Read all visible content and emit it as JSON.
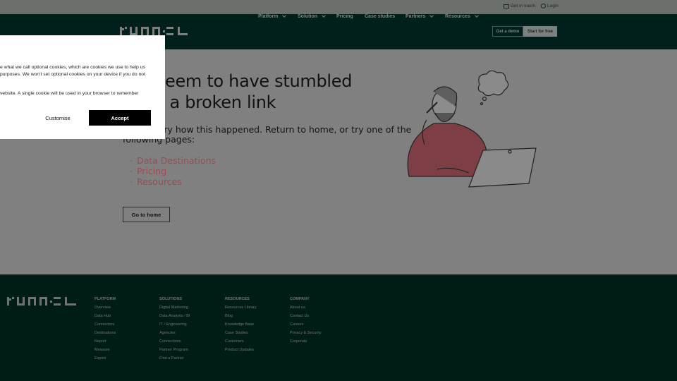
{
  "topbar": {
    "get_in_touch": "Get in touch",
    "login": "Login"
  },
  "header": {
    "logo": "FUNNEL",
    "nav": [
      {
        "label": "Platform",
        "dropdown": true
      },
      {
        "label": "Solution",
        "dropdown": true
      },
      {
        "label": "Pricing",
        "dropdown": false
      },
      {
        "label": "Case studies",
        "dropdown": false
      },
      {
        "label": "Partners",
        "dropdown": true
      },
      {
        "label": "Resources",
        "dropdown": true
      }
    ],
    "demo": "Get a demo",
    "free": "Start for free"
  },
  "main": {
    "heading_line1": "You seem to have stumbled",
    "heading_line2": "upon a broken link",
    "para_line1": "We're sorry how this happened. Return to home, or try one of the",
    "para_line2": "following pages:",
    "links": [
      "Data Destinations",
      "Pricing",
      "Resources"
    ],
    "bullet": "·",
    "home_button": "Go to home",
    "accent": "#c25a63"
  },
  "footer": {
    "logo": "FUNNEL",
    "columns": [
      {
        "title": "PLATFORM",
        "items": [
          "Overview",
          "Data Hub",
          "Connectors",
          "Destinations",
          "Report",
          "Measure",
          "Export"
        ]
      },
      {
        "title": "SOLUTIONS",
        "items": [
          "Digital Marketing",
          "Data Analysts / BI",
          "IT / Engineering",
          "Agencies",
          "Connections",
          "Partner Program",
          "Find a Partner"
        ]
      },
      {
        "title": "RESOURCES",
        "items": [
          "Resources Library",
          "Blog",
          "Knowledge Base",
          "Case Studies",
          "Customers",
          "Product Updates"
        ]
      },
      {
        "title": "COMPANY",
        "items": [
          "About us",
          "Contact Us",
          "Careers",
          "Privacy & Security",
          "Corporate"
        ]
      }
    ]
  },
  "cookie": {
    "line1": "e what we call optional cookies, which are cookies we use to help us",
    "line2": "purposes. We won't set optional cookies on your device if you do not",
    "line3": "vebsite. A single cookie will be used in your browser to remember",
    "customise": "Customise",
    "accept": "Accept"
  }
}
